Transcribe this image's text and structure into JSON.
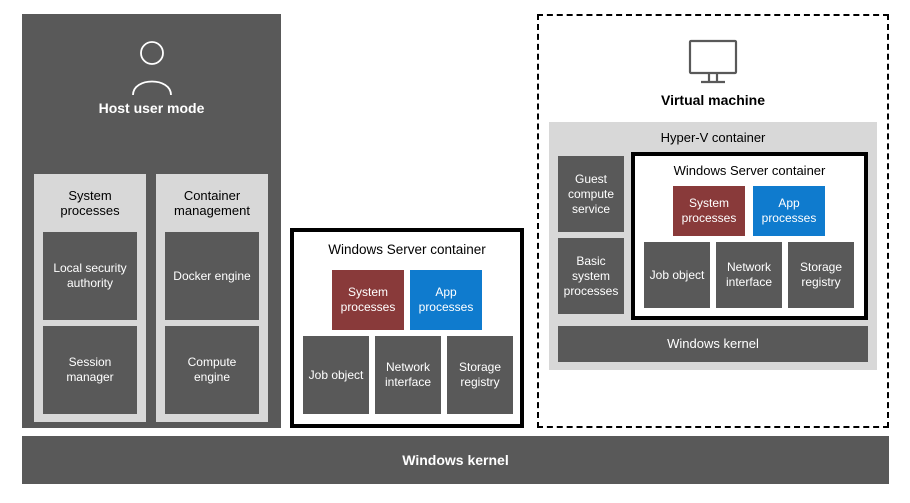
{
  "host": {
    "title": "Host user mode",
    "sys_proc": {
      "header": "System processes",
      "items": [
        "Local security authority",
        "Session manager"
      ]
    },
    "cont_mgmt": {
      "header": "Container management",
      "items": [
        "Docker engine",
        "Compute engine"
      ]
    }
  },
  "wsc": {
    "title": "Windows Server container",
    "sys": "System processes",
    "app": "App processes",
    "job": "Job object",
    "net": "Network interface",
    "store": "Storage registry"
  },
  "vm": {
    "title": "Virtual machine",
    "hv_title": "Hyper-V container",
    "guest": "Guest compute service",
    "basic": "Basic system processes",
    "kernel": "Windows kernel",
    "wsc": {
      "title": "Windows Server container",
      "sys": "System processes",
      "app": "App processes",
      "job": "Job object",
      "net": "Network interface",
      "store": "Storage registry"
    }
  },
  "bottom_kernel": "Windows kernel",
  "colors": {
    "dark": "#595959",
    "light": "#d8d8d8",
    "red": "#893a3a",
    "blue": "#0f7bce"
  }
}
